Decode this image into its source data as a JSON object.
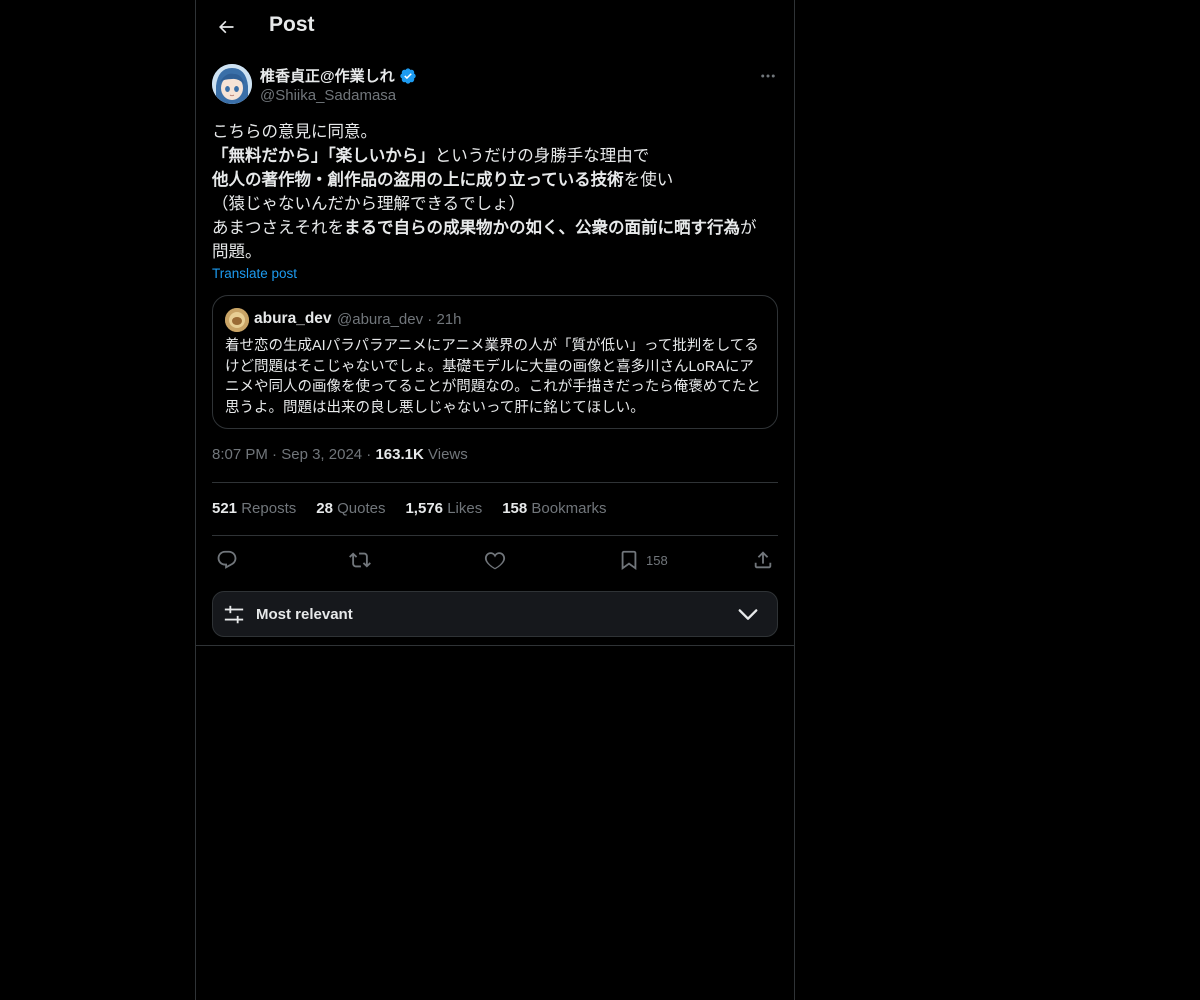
{
  "header": {
    "title": "Post"
  },
  "post": {
    "display_name": "椎香貞正@作業しれ",
    "handle": "@Shiika_Sadamasa",
    "text": {
      "l1": "こちらの意見に同意。",
      "l2_bold": "「無料だから」「楽しいから」",
      "l2_rest": "というだけの身勝手な理由で",
      "l3_bold": "他人の著作物・創作品の盗用の上に成り立っている技術",
      "l3_rest": "を使い",
      "l4": "（猿じゃないんだから理解できるでしょ）",
      "l5_a": "あまつさえそれを",
      "l5_bold": "まるで自らの成果物かの如く、公衆の面前に晒す行為",
      "l5_b": "が",
      "l6": "問題。"
    },
    "translate_label": "Translate post",
    "quote": {
      "name": "abura_dev",
      "handle": "@abura_dev",
      "sep": "·",
      "age": "21h",
      "text": "着せ恋の生成AIパラパラアニメにアニメ業界の人が「質が低い」って批判をしてるけど問題はそこじゃないでしょ。基礎モデルに大量の画像と喜多川さんLoRAにアニメや同人の画像を使ってることが問題なの。これが手描きだったら俺褒めてたと思うよ。問題は出来の良し悪しじゃないって肝に銘じてほしい。"
    },
    "time": "8:07 PM",
    "date": "Sep 3, 2024",
    "views_count": "163.1K",
    "views_label": "Views",
    "dot": "·"
  },
  "stats": [
    {
      "count": "521",
      "label": "Reposts"
    },
    {
      "count": "28",
      "label": "Quotes"
    },
    {
      "count": "1,576",
      "label": "Likes"
    },
    {
      "count": "158",
      "label": "Bookmarks"
    }
  ],
  "actions": {
    "bookmark_count": "158"
  },
  "sort": {
    "label": "Most relevant"
  },
  "colors": {
    "accent": "#1d9bf0",
    "verified": "#1d9bf0",
    "muted": "#71767b",
    "border": "#2f3336"
  }
}
